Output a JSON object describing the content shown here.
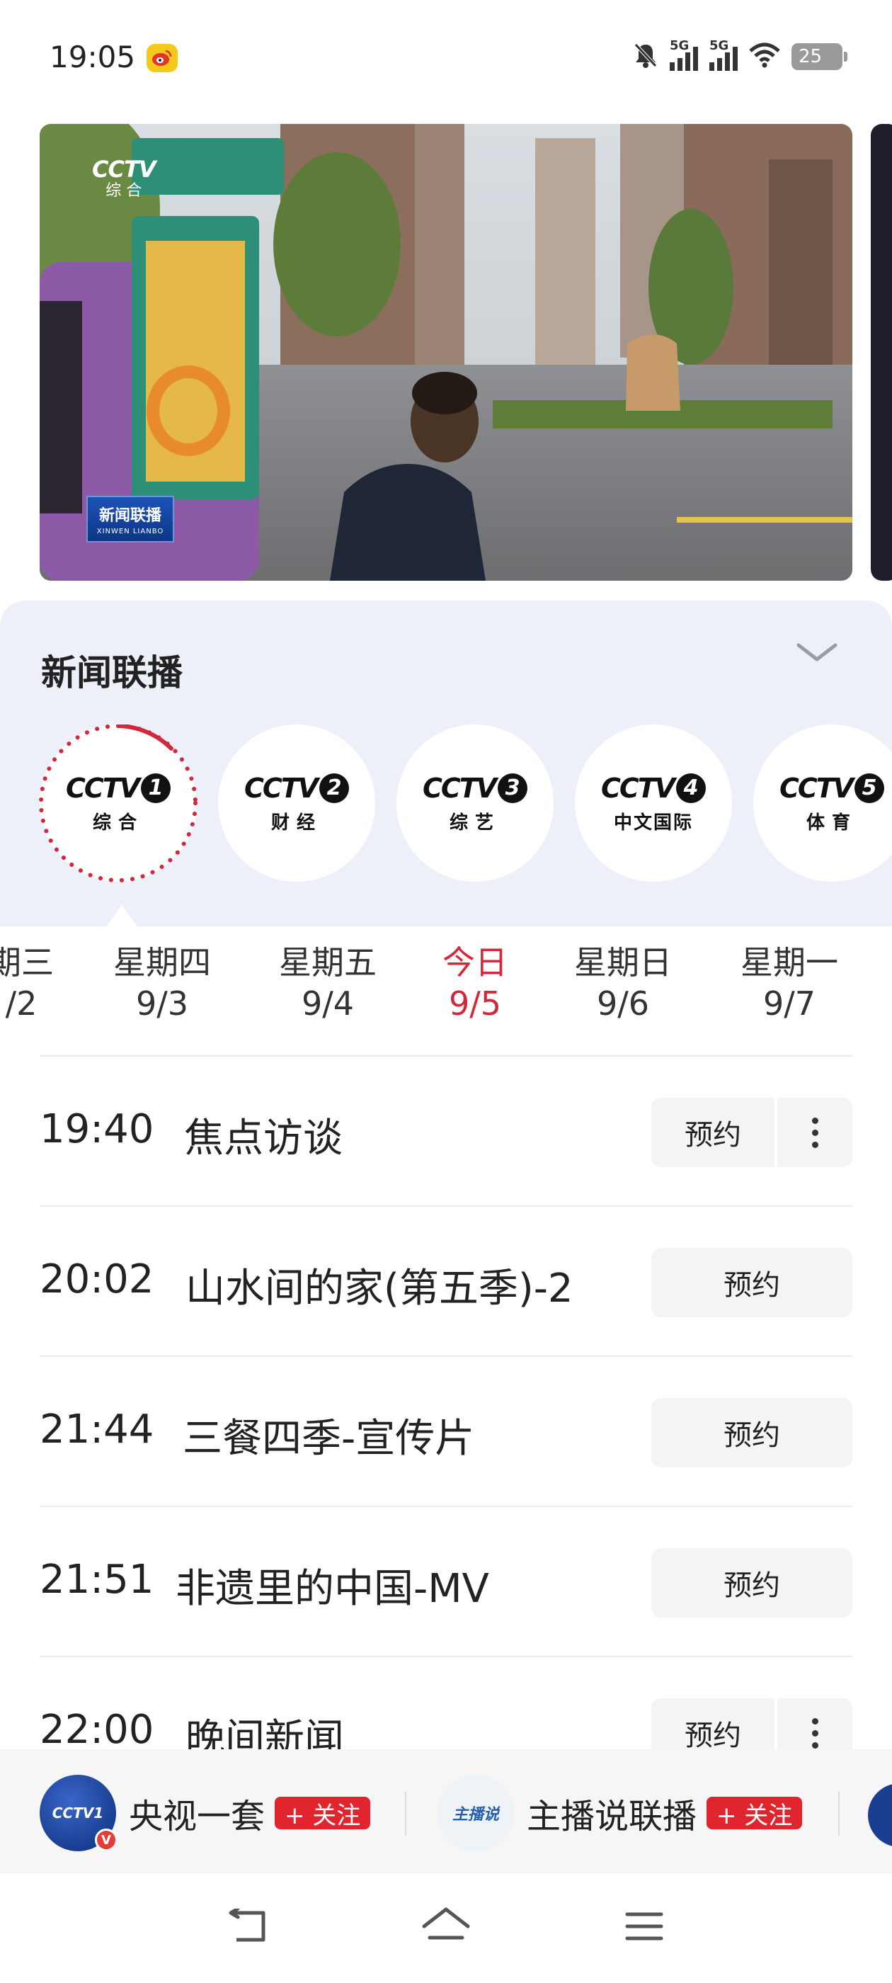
{
  "status_bar": {
    "time": "19:05",
    "net1": "5G",
    "net2": "5G",
    "battery": "25",
    "icons": [
      "weibo-icon",
      "mute-icon",
      "signal-icon",
      "wifi-icon",
      "battery-icon"
    ]
  },
  "video": {
    "channel_bug": "CCTV",
    "channel_bug_sub": "综 合",
    "badge_main": "新闻联播",
    "badge_sub": "XINWEN LIANBO"
  },
  "panel": {
    "title": "新闻联播",
    "channels": [
      {
        "logo": "CCTV",
        "number": "1",
        "name": "综合",
        "active": true
      },
      {
        "logo": "CCTV",
        "number": "2",
        "name": "财经",
        "active": false
      },
      {
        "logo": "CCTV",
        "number": "3",
        "name": "综艺",
        "active": false
      },
      {
        "logo": "CCTV",
        "number": "4",
        "name": "中文国际",
        "active": false
      },
      {
        "logo": "CCTV",
        "number": "5",
        "name": "体育",
        "active": false
      }
    ]
  },
  "dates": [
    {
      "day": "期三",
      "date": "/2"
    },
    {
      "day": "星期四",
      "date": "9/3"
    },
    {
      "day": "星期五",
      "date": "9/4"
    },
    {
      "day": "今日",
      "date": "9/5",
      "today": true
    },
    {
      "day": "星期日",
      "date": "9/6"
    },
    {
      "day": "星期一",
      "date": "9/7"
    }
  ],
  "schedule": [
    {
      "time": "19:40",
      "title": "焦点访谈",
      "action": "预约",
      "has_more": true
    },
    {
      "time": "20:02",
      "title": "山水间的家(第五季)-2",
      "action": "预约",
      "has_more": false
    },
    {
      "time": "21:44",
      "title": "三餐四季-宣传片",
      "action": "预约",
      "has_more": false
    },
    {
      "time": "21:51",
      "title": "非遗里的中国-MV",
      "action": "预约",
      "has_more": false
    },
    {
      "time": "22:00",
      "title": "晚间新闻",
      "action": "预约",
      "has_more": true
    }
  ],
  "follow_bar": {
    "accounts": [
      {
        "name": "央视一套",
        "follow_label": "+ 关注",
        "avatar_text": "CCTV1"
      },
      {
        "name": "主播说联播",
        "follow_label": "+ 关注",
        "avatar_text": "主播说"
      }
    ]
  },
  "nav": {
    "icons": [
      "back-icon",
      "home-icon",
      "menu-icon"
    ]
  },
  "colors": {
    "accent": "#d3273c",
    "panel_bg": "#edf0f9",
    "follow_red": "#e1252f"
  }
}
